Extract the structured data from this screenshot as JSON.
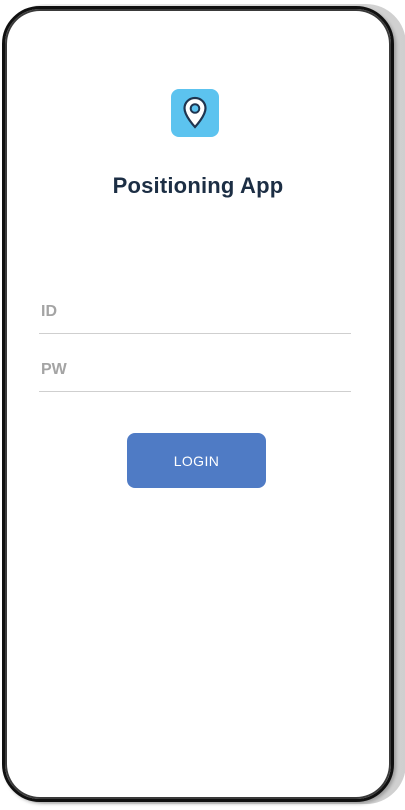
{
  "app": {
    "title": "Positioning App",
    "logo_icon": "location-pin-icon",
    "logo_color": "#5cc3ef"
  },
  "form": {
    "id_placeholder": "ID",
    "id_value": "",
    "pw_placeholder": "PW",
    "pw_value": ""
  },
  "login": {
    "label": "LOGIN",
    "color": "#4f7bc5"
  }
}
